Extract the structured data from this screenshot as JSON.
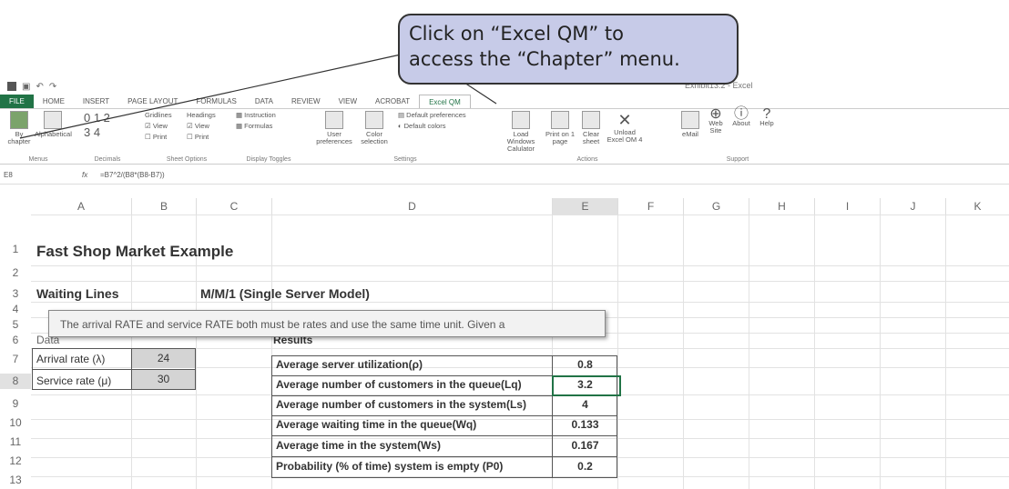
{
  "callout": {
    "line1": "Click on “Excel QM” to",
    "line2": "access the “Chapter” menu."
  },
  "window": {
    "title": "Exhibit13.2 - Excel"
  },
  "tabs": [
    "FILE",
    "HOME",
    "INSERT",
    "PAGE LAYOUT",
    "FORMULAS",
    "DATA",
    "REVIEW",
    "VIEW",
    "ACROBAT",
    "Excel QM"
  ],
  "ribbon": {
    "menus": {
      "by_chapter": "By chapter",
      "alphabetical": "Alphabetical",
      "label": "Menus"
    },
    "decimals": {
      "digits": "0 1 2",
      "digits2": "3 4",
      "label": "Decimals"
    },
    "sheet_options": {
      "gridlines": "Gridlines",
      "headings": "Headings",
      "view": "View",
      "print": "Print",
      "label": "Sheet Options"
    },
    "display": {
      "instruction": "Instruction",
      "formulas": "Formulas",
      "label": "Display Toggles"
    },
    "settings": {
      "user_prefs": "User preferences",
      "color_sel": "Color selection",
      "default_prefs": "Default preferences",
      "default_colors": "Default colors",
      "label": "Settings"
    },
    "actions": {
      "load_windows": "Load Windows Calulator",
      "print_one": "Print on 1 page",
      "clear_sheet": "Clear sheet",
      "unload": "Unload Excel OM 4",
      "label": "Actions"
    },
    "support": {
      "email": "eMail",
      "web": "Web Site",
      "about": "About",
      "help": "Help",
      "label": "Support"
    }
  },
  "formula_bar": {
    "cell_ref": "E8",
    "fx": "fx",
    "formula": "=B7^2/(B8*(B8-B7))"
  },
  "columns": [
    "A",
    "B",
    "C",
    "D",
    "E",
    "F",
    "G",
    "H",
    "I",
    "J",
    "K"
  ],
  "rows": [
    "1",
    "2",
    "3",
    "4",
    "5",
    "6",
    "7",
    "8",
    "9",
    "10",
    "11",
    "12",
    "13"
  ],
  "sheet": {
    "title": "Fast Shop Market Example",
    "waiting_lines": "Waiting Lines",
    "model": "M/M/1 (Single Server Model)",
    "data_label": "Data",
    "arrival_label": "Arrival rate (λ)",
    "arrival_value": "24",
    "service_label": "Service rate (μ)",
    "service_value": "30",
    "results_label": "Results",
    "results": [
      {
        "label": "Average server utilization(ρ)",
        "value": "0.8"
      },
      {
        "label": "Average number of customers in the queue(Lq)",
        "value": "3.2"
      },
      {
        "label": "Average number of customers in the system(Ls)",
        "value": "4"
      },
      {
        "label": "Average waiting time in the queue(Wq)",
        "value": "0.133"
      },
      {
        "label": "Average time in the system(Ws)",
        "value": "0.167"
      },
      {
        "label": "Probability (% of time) system is empty (P0)",
        "value": "0.2"
      }
    ]
  },
  "tooltip": "The arrival RATE and service RATE both must be rates and use the same time unit. Given a"
}
